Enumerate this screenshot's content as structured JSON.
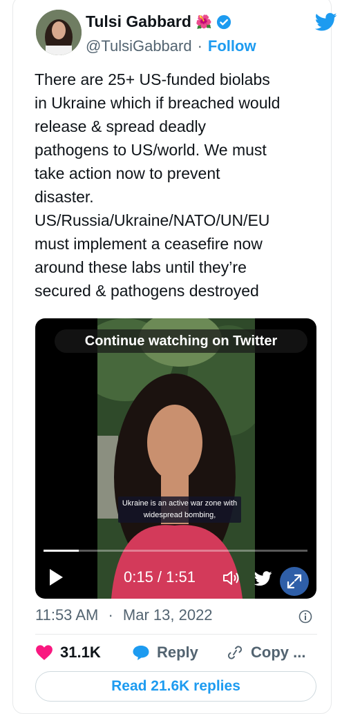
{
  "author": {
    "name": "Tulsi Gabbard",
    "flower_emoji": "🌺",
    "handle": "@TulsiGabbard",
    "separator": "·",
    "follow_label": "Follow"
  },
  "tweet": {
    "text": "There are 25+ US-funded biolabs\nin Ukraine which if breached would\nrelease & spread deadly\npathogens to US/world. We must\ntake action now to prevent\ndisaster.\nUS/Russia/Ukraine/NATO/UN/EU\nmust implement a ceasefire now\naround these labs until they’re\nsecured & pathogens destroyed"
  },
  "video": {
    "overlay_label": "Continue watching on Twitter",
    "caption": "Ukraine is an active war zone with widespread bombing,",
    "time_display": "0:15 / 1:51",
    "progress_fraction": 0.133
  },
  "meta": {
    "time": "11:53 AM",
    "separator": "·",
    "date": "Mar 13, 2022"
  },
  "actions": {
    "like_count": "31.1K",
    "reply_label": "Reply",
    "copy_label": "Copy ..."
  },
  "read_replies_label": "Read 21.6K replies",
  "colors": {
    "accent": "#1d9bf0",
    "like": "#f91880",
    "muted": "#536471"
  },
  "icons": [
    "verified-icon",
    "twitter-bird-icon",
    "play-icon",
    "volume-icon",
    "expand-icon",
    "info-icon",
    "heart-icon",
    "reply-bubble-icon",
    "link-icon"
  ]
}
